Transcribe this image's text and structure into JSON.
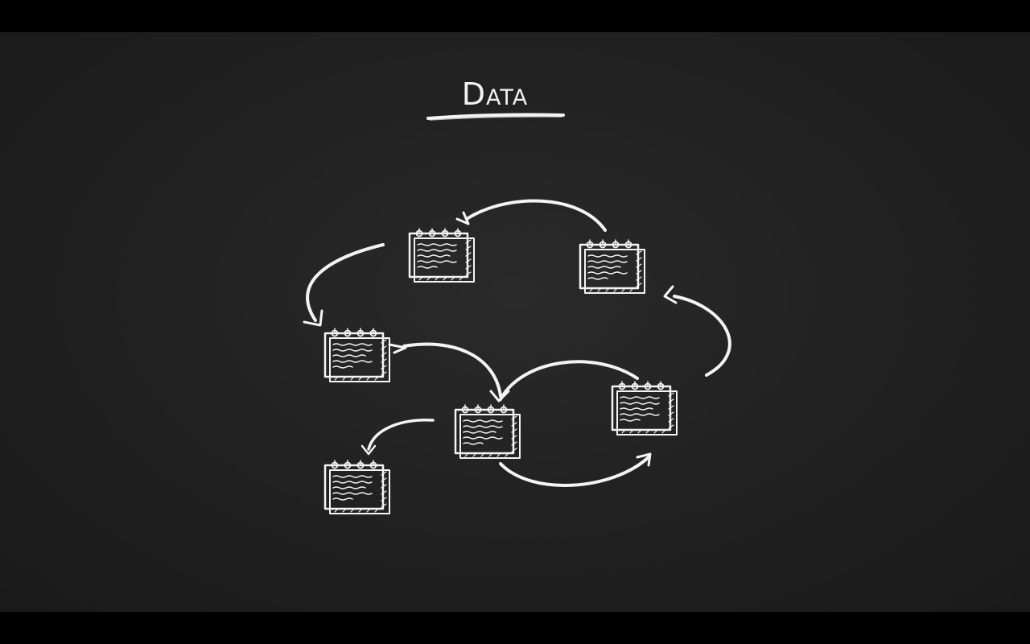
{
  "slide": {
    "title": "Data",
    "background_color": "#222222",
    "chalk_color": "#f4f4f4"
  },
  "diagram": {
    "nodes": [
      {
        "id": "doc-1",
        "icon": "notepad-icon"
      },
      {
        "id": "doc-2",
        "icon": "notepad-icon"
      },
      {
        "id": "doc-3",
        "icon": "notepad-icon"
      },
      {
        "id": "doc-4",
        "icon": "notepad-icon"
      },
      {
        "id": "doc-5",
        "icon": "notepad-icon"
      },
      {
        "id": "doc-6",
        "icon": "notepad-icon"
      }
    ],
    "edges": [
      {
        "from": "doc-2",
        "to": "doc-1"
      },
      {
        "from": "doc-1",
        "to": "doc-3"
      },
      {
        "from": "doc-3",
        "to": "doc-4"
      },
      {
        "from": "doc-5",
        "to": "doc-4"
      },
      {
        "from": "doc-4",
        "to": "doc-5"
      },
      {
        "from": "doc-5",
        "to": "doc-2"
      },
      {
        "from": "doc-4",
        "to": "doc-6"
      }
    ]
  }
}
